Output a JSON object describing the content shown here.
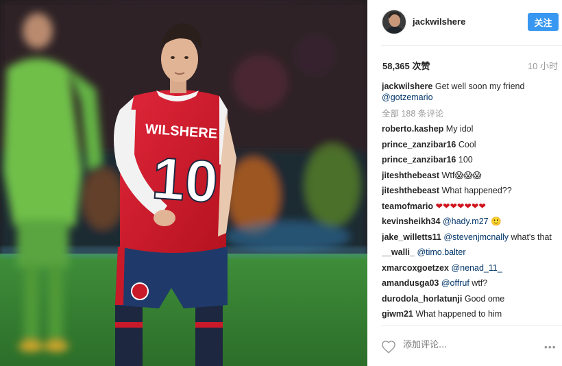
{
  "photo": {
    "jersey_name": "WILSHERE",
    "jersey_number": "10"
  },
  "header": {
    "username": "jackwilshere",
    "follow_label": "关注"
  },
  "stats": {
    "likes": "58,365 次赞",
    "time": "10 小时"
  },
  "caption": {
    "user": "jackwilshere",
    "text": "Get well soon my friend",
    "mention": "@gotzemario"
  },
  "load_more": "全部 188 条评论",
  "comments": [
    {
      "user": "roberto.kashep",
      "text": "My idol"
    },
    {
      "user": "prince_zanzibar16",
      "text": "Cool"
    },
    {
      "user": "prince_zanzibar16",
      "text": "100"
    },
    {
      "user": "jiteshthebeast",
      "text": "Wtf😱😱😱"
    },
    {
      "user": "jiteshthebeast",
      "text": "What happened??"
    },
    {
      "user": "teamofmario",
      "text": "❤❤❤❤❤❤❤",
      "red": true
    },
    {
      "user": "kevinsheikh34",
      "mention": "@hady.m27",
      "text": "🙂"
    },
    {
      "user": "jake_willetts11",
      "mention": "@stevenjmcnally",
      "text": "what's that"
    },
    {
      "user": "__walli_",
      "mention": "@timo.balter",
      "text": ""
    },
    {
      "user": "xmarcoxgoetzex",
      "mention": "@nenad_11_",
      "text": ""
    },
    {
      "user": "amandusga03",
      "mention": "@offruf",
      "text": "wtf?"
    },
    {
      "user": "durodola_horlatunji",
      "text": "Good ome"
    },
    {
      "user": "giwm21",
      "text": "What happened to him"
    }
  ],
  "footer": {
    "comment_placeholder": "添加评论...",
    "more_icon": "more-options-icon",
    "like_icon": "heart-icon"
  },
  "colors": {
    "follow_blue": "#3897f0",
    "mention": "#003569",
    "muted": "#999999"
  }
}
